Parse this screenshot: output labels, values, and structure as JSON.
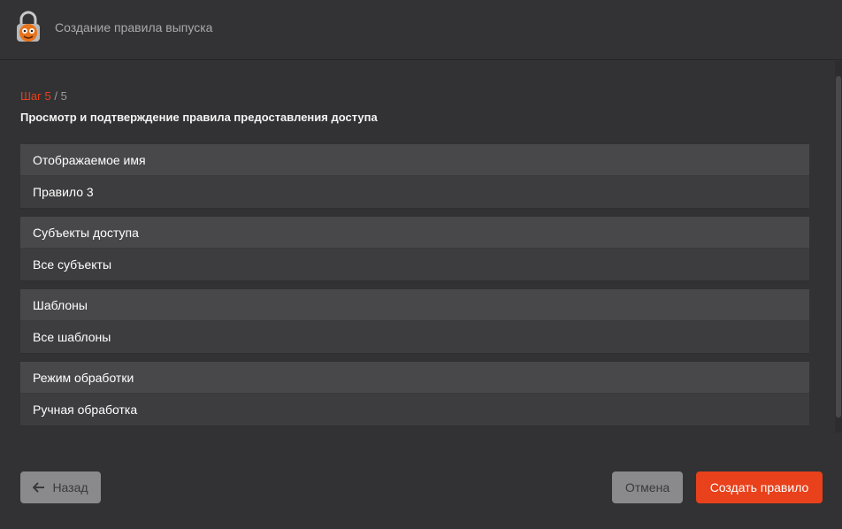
{
  "header": {
    "title": "Создание правила выпуска",
    "logo_icon": "padlock-mascot-icon"
  },
  "wizard": {
    "step_current": "Шаг 5",
    "step_total": "/ 5",
    "subtitle": "Просмотр и подтверждение правила предоставления доступа"
  },
  "sections": [
    {
      "label": "Отображаемое имя",
      "value": "Правило 3"
    },
    {
      "label": "Субъекты доступа",
      "value": "Все субъекты"
    },
    {
      "label": "Шаблоны",
      "value": "Все шаблоны"
    },
    {
      "label": "Режим обработки",
      "value": "Ручная обработка"
    }
  ],
  "footer": {
    "back_label": "Назад",
    "cancel_label": "Отмена",
    "create_label": "Создать правило"
  },
  "colors": {
    "accent": "#e8411b",
    "background": "#323234",
    "label_row": "#48484a",
    "value_row": "#3d3d3f",
    "secondary_button": "#8a8a8c"
  }
}
